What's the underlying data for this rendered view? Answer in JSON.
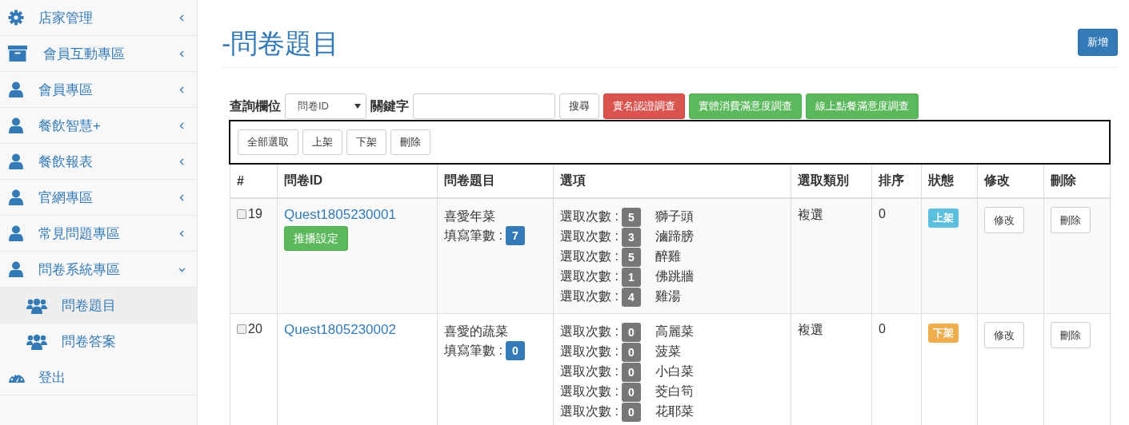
{
  "sidebar": {
    "items": [
      {
        "label": "店家管理",
        "kind": "settings",
        "expanded": false
      },
      {
        "label": "會員互動專區",
        "kind": "interaction",
        "expanded": false
      },
      {
        "label": "會員專區",
        "kind": "section",
        "expanded": false
      },
      {
        "label": "餐飲智慧+",
        "kind": "section",
        "expanded": false
      },
      {
        "label": "餐飲報表",
        "kind": "section",
        "expanded": false
      },
      {
        "label": "官網專區",
        "kind": "section",
        "expanded": false
      },
      {
        "label": "常見問題專區",
        "kind": "section",
        "expanded": false
      },
      {
        "label": "問卷系統專區",
        "kind": "section",
        "expanded": true,
        "children": [
          {
            "label": "問卷題目",
            "selected": true
          },
          {
            "label": "問卷答案",
            "selected": false
          }
        ]
      },
      {
        "label": "登出",
        "kind": "logout"
      }
    ]
  },
  "page": {
    "title": "-問卷題目",
    "add_button": "新增"
  },
  "search": {
    "field_label": "查詢欄位",
    "field_select": "問卷ID",
    "keyword_label": "關鍵字",
    "search_button": "搜尋",
    "survey_buttons": [
      {
        "label": "實名認證調查",
        "kind": "danger"
      },
      {
        "label": "實體消費滿意度調查",
        "kind": "success"
      },
      {
        "label": "線上點餐滿意度調查",
        "kind": "success"
      }
    ]
  },
  "toolbar": [
    "全部選取",
    "上架",
    "下架",
    "刪除"
  ],
  "table": {
    "columns": [
      "#",
      "問卷ID",
      "問卷題目",
      "選項",
      "選取類別",
      "排序",
      "狀態",
      "修改",
      "刪除"
    ],
    "rows": [
      {
        "checked": false,
        "number": "19",
        "id": "Quest1805230001",
        "push_button": "推播設定",
        "title": "喜愛年菜",
        "count_label": "填寫筆數 :",
        "count": "7",
        "options": [
          {
            "label": "選取次數 :",
            "count": "5",
            "name": "獅子頭"
          },
          {
            "label": "選取次數 :",
            "count": "3",
            "name": "滷蹄膀"
          },
          {
            "label": "選取次數 :",
            "count": "5",
            "name": "醉雞"
          },
          {
            "label": "選取次數 :",
            "count": "1",
            "name": "佛跳牆"
          },
          {
            "label": "選取次數 :",
            "count": "4",
            "name": "雞湯"
          }
        ],
        "type": "複選",
        "order": "0",
        "status": {
          "label": "上架",
          "kind": "on"
        },
        "edit": "修改",
        "delete": "刪除"
      },
      {
        "checked": false,
        "number": "20",
        "id": "Quest1805230002",
        "title": "喜愛的蔬菜",
        "count_label": "填寫筆數 :",
        "count": "0",
        "options": [
          {
            "label": "選取次數 :",
            "count": "0",
            "name": "高麗菜"
          },
          {
            "label": "選取次數 :",
            "count": "0",
            "name": "菠菜"
          },
          {
            "label": "選取次數 :",
            "count": "0",
            "name": "小白菜"
          },
          {
            "label": "選取次數 :",
            "count": "0",
            "name": "茭白筍"
          },
          {
            "label": "選取次數 :",
            "count": "0",
            "name": "花耶菜"
          }
        ],
        "type": "複選",
        "order": "0",
        "status": {
          "label": "下架",
          "kind": "off"
        },
        "edit": "修改",
        "delete": "刪除"
      }
    ]
  }
}
